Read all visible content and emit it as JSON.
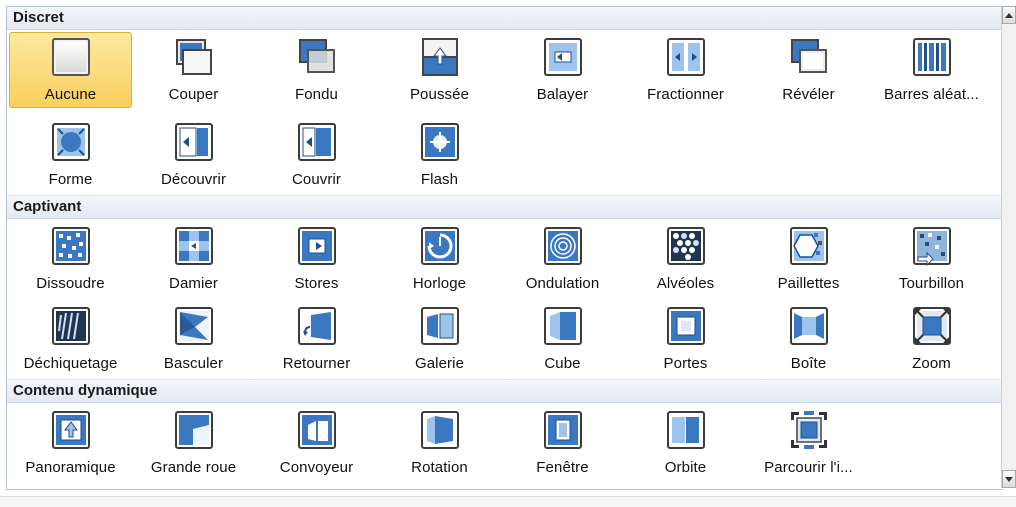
{
  "sections": [
    {
      "title": "Discret",
      "rows": [
        [
          {
            "label": "Aucune",
            "icon": "none-transition-icon",
            "selected": true
          },
          {
            "label": "Couper",
            "icon": "cut-transition-icon"
          },
          {
            "label": "Fondu",
            "icon": "fade-transition-icon"
          },
          {
            "label": "Poussée",
            "icon": "push-transition-icon"
          },
          {
            "label": "Balayer",
            "icon": "wipe-transition-icon"
          },
          {
            "label": "Fractionner",
            "icon": "split-transition-icon"
          },
          {
            "label": "Révéler",
            "icon": "reveal-transition-icon"
          },
          {
            "label": "Barres aléat...",
            "icon": "random-bars-transition-icon"
          }
        ],
        [
          {
            "label": "Forme",
            "icon": "shape-transition-icon"
          },
          {
            "label": "Découvrir",
            "icon": "uncover-transition-icon"
          },
          {
            "label": "Couvrir",
            "icon": "cover-transition-icon"
          },
          {
            "label": "Flash",
            "icon": "flash-transition-icon"
          }
        ]
      ]
    },
    {
      "title": "Captivant",
      "rows": [
        [
          {
            "label": "Dissoudre",
            "icon": "dissolve-transition-icon"
          },
          {
            "label": "Damier",
            "icon": "checkerboard-transition-icon"
          },
          {
            "label": "Stores",
            "icon": "blinds-transition-icon"
          },
          {
            "label": "Horloge",
            "icon": "clock-transition-icon"
          },
          {
            "label": "Ondulation",
            "icon": "ripple-transition-icon"
          },
          {
            "label": "Alvéoles",
            "icon": "honeycomb-transition-icon"
          },
          {
            "label": "Paillettes",
            "icon": "glitter-transition-icon"
          },
          {
            "label": "Tourbillon",
            "icon": "vortex-transition-icon"
          }
        ],
        [
          {
            "label": "Déchiquetage",
            "icon": "shred-transition-icon"
          },
          {
            "label": "Basculer",
            "icon": "switch-transition-icon"
          },
          {
            "label": "Retourner",
            "icon": "flip-transition-icon"
          },
          {
            "label": "Galerie",
            "icon": "gallery-transition-icon"
          },
          {
            "label": "Cube",
            "icon": "cube-transition-icon"
          },
          {
            "label": "Portes",
            "icon": "doors-transition-icon"
          },
          {
            "label": "Boîte",
            "icon": "box-transition-icon"
          },
          {
            "label": "Zoom",
            "icon": "zoom-transition-icon"
          }
        ]
      ]
    },
    {
      "title": "Contenu dynamique",
      "rows": [
        [
          {
            "label": "Panoramique",
            "icon": "pan-transition-icon"
          },
          {
            "label": "Grande roue",
            "icon": "ferris-wheel-transition-icon"
          },
          {
            "label": "Convoyeur",
            "icon": "conveyor-transition-icon"
          },
          {
            "label": "Rotation",
            "icon": "rotate-transition-icon"
          },
          {
            "label": "Fenêtre",
            "icon": "window-transition-icon"
          },
          {
            "label": "Orbite",
            "icon": "orbit-transition-icon"
          },
          {
            "label": "Parcourir l'i...",
            "icon": "fly-through-transition-icon"
          }
        ]
      ]
    }
  ],
  "colors": {
    "selected_top": "#fde9a2",
    "selected_bottom": "#f9cf5c",
    "icon_blue": "#3a78c2",
    "icon_blue_light": "#9cc4ec",
    "icon_frame": "#4a4a4a"
  }
}
